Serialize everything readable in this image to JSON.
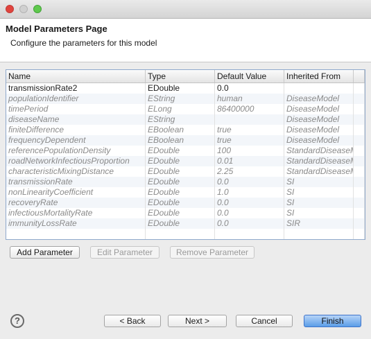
{
  "page": {
    "title": "Model Parameters Page",
    "description": "Configure the parameters for this model"
  },
  "table": {
    "columns": [
      "Name",
      "Type",
      "Default Value",
      "Inherited From"
    ],
    "rows": [
      {
        "name": "transmissionRate2",
        "type": "EDouble",
        "default": "0.0",
        "inherited_from": "",
        "inherited": false
      },
      {
        "name": "populationIdentifier",
        "type": "EString",
        "default": "human",
        "inherited_from": "DiseaseModel",
        "inherited": true
      },
      {
        "name": "timePeriod",
        "type": "ELong",
        "default": "86400000",
        "inherited_from": "DiseaseModel",
        "inherited": true
      },
      {
        "name": "diseaseName",
        "type": "EString",
        "default": "",
        "inherited_from": "DiseaseModel",
        "inherited": true
      },
      {
        "name": "finiteDifference",
        "type": "EBoolean",
        "default": "true",
        "inherited_from": "DiseaseModel",
        "inherited": true
      },
      {
        "name": "frequencyDependent",
        "type": "EBoolean",
        "default": "true",
        "inherited_from": "DiseaseModel",
        "inherited": true
      },
      {
        "name": "referencePopulationDensity",
        "type": "EDouble",
        "default": "100",
        "inherited_from": "StandardDiseaseM",
        "inherited": true
      },
      {
        "name": "roadNetworkInfectiousProportion",
        "type": "EDouble",
        "default": "0.01",
        "inherited_from": "StandardDiseaseM",
        "inherited": true
      },
      {
        "name": "characteristicMixingDistance",
        "type": "EDouble",
        "default": "2.25",
        "inherited_from": "StandardDiseaseM",
        "inherited": true
      },
      {
        "name": "transmissionRate",
        "type": "EDouble",
        "default": "0.0",
        "inherited_from": "SI",
        "inherited": true
      },
      {
        "name": "nonLinearityCoefficient",
        "type": "EDouble",
        "default": "1.0",
        "inherited_from": "SI",
        "inherited": true
      },
      {
        "name": "recoveryRate",
        "type": "EDouble",
        "default": "0.0",
        "inherited_from": "SI",
        "inherited": true
      },
      {
        "name": "infectiousMortalityRate",
        "type": "EDouble",
        "default": "0.0",
        "inherited_from": "SI",
        "inherited": true
      },
      {
        "name": "immunityLossRate",
        "type": "EDouble",
        "default": "0.0",
        "inherited_from": "SIR",
        "inherited": true
      }
    ],
    "empty_rows": 1
  },
  "buttons": {
    "add": "Add Parameter",
    "edit": "Edit Parameter",
    "remove": "Remove Parameter",
    "back": "< Back",
    "next": "Next >",
    "cancel": "Cancel",
    "finish": "Finish"
  },
  "help": {
    "icon": "help-icon",
    "glyph": "?"
  },
  "colors": {
    "accent": "#5a9de8",
    "table_border": "#8fa9cc",
    "inherited_text": "#8a8a8a"
  }
}
